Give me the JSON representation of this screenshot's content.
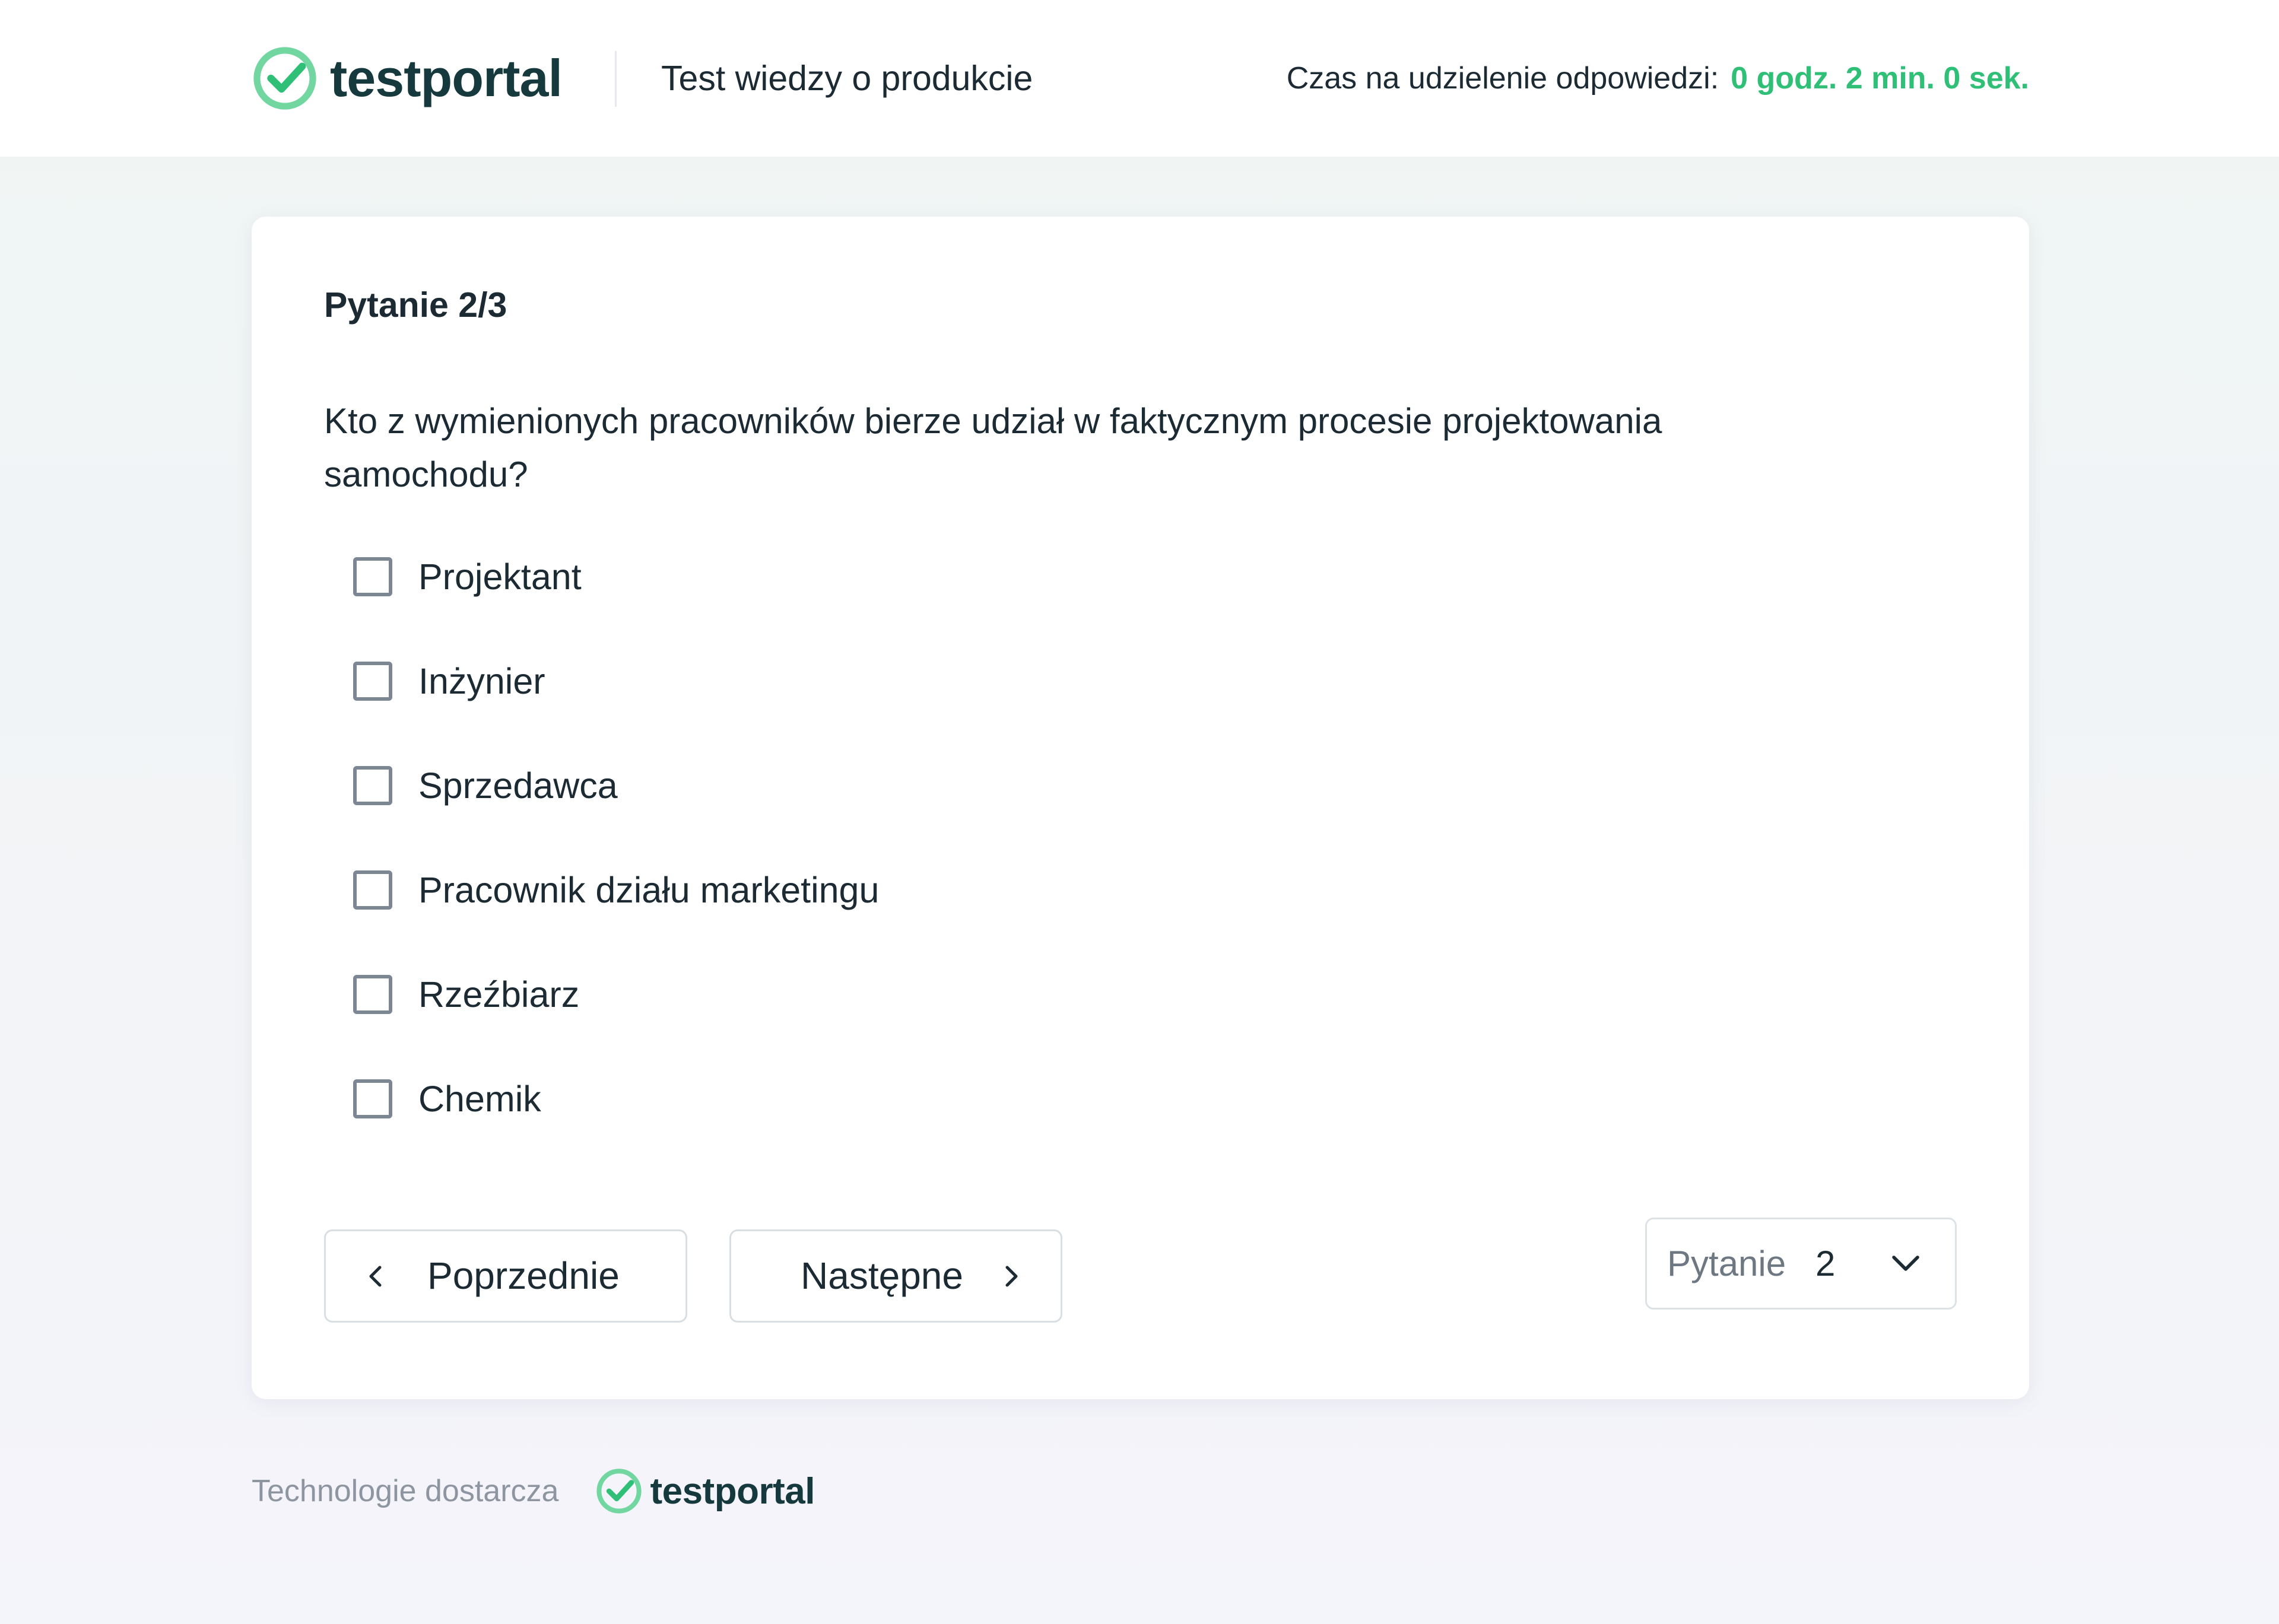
{
  "header": {
    "logo_text": "testportal",
    "test_title": "Test wiedzy o produkcie",
    "timer_label": "Czas na udzielenie odpowiedzi:",
    "timer_value": "0 godz. 2 min. 0 sek."
  },
  "question": {
    "counter": "Pytanie 2/3",
    "text": "Kto z wymienionych pracowników bierze udział w faktycznym procesie projektowania samochodu?",
    "options": [
      {
        "label": "Projektant",
        "checked": false
      },
      {
        "label": "Inżynier",
        "checked": false
      },
      {
        "label": "Sprzedawca",
        "checked": false
      },
      {
        "label": "Pracownik działu marketingu",
        "checked": false
      },
      {
        "label": "Rzeźbiarz",
        "checked": false
      },
      {
        "label": "Chemik",
        "checked": false
      }
    ]
  },
  "navigation": {
    "prev_label": "Poprzednie",
    "prev_icon": "chevron-left-icon",
    "next_label": "Następne",
    "next_icon": "chevron-right-icon",
    "question_select": {
      "label": "Pytanie",
      "value": "2",
      "icon": "chevron-down-icon"
    }
  },
  "footer": {
    "powered_by": "Technologie dostarcza",
    "logo_text": "testportal"
  },
  "colors": {
    "accent": "#2fbf77",
    "logo_ring": "#72d6a0",
    "text": "#1b2a33",
    "logo_text": "#15393d",
    "muted": "#8d96a0",
    "border": "#d9dee3"
  }
}
